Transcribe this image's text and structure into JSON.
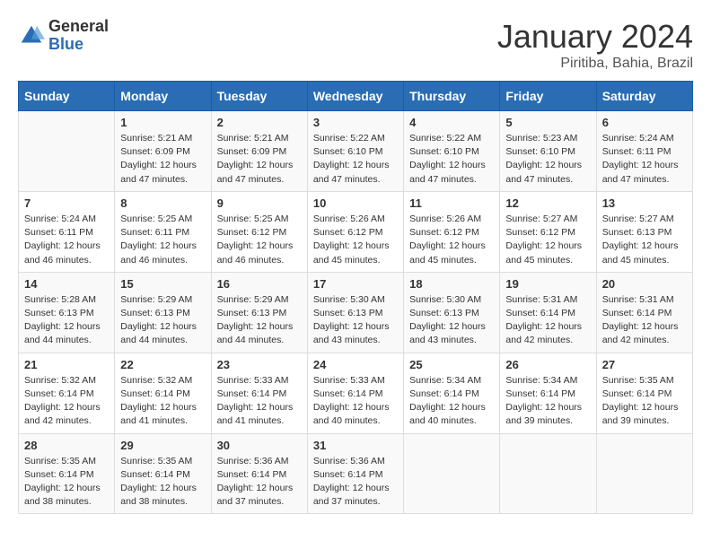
{
  "header": {
    "logo_general": "General",
    "logo_blue": "Blue",
    "title": "January 2024",
    "location": "Piritiba, Bahia, Brazil"
  },
  "weekdays": [
    "Sunday",
    "Monday",
    "Tuesday",
    "Wednesday",
    "Thursday",
    "Friday",
    "Saturday"
  ],
  "weeks": [
    [
      {
        "day": "",
        "info": ""
      },
      {
        "day": "1",
        "info": "Sunrise: 5:21 AM\nSunset: 6:09 PM\nDaylight: 12 hours\nand 47 minutes."
      },
      {
        "day": "2",
        "info": "Sunrise: 5:21 AM\nSunset: 6:09 PM\nDaylight: 12 hours\nand 47 minutes."
      },
      {
        "day": "3",
        "info": "Sunrise: 5:22 AM\nSunset: 6:10 PM\nDaylight: 12 hours\nand 47 minutes."
      },
      {
        "day": "4",
        "info": "Sunrise: 5:22 AM\nSunset: 6:10 PM\nDaylight: 12 hours\nand 47 minutes."
      },
      {
        "day": "5",
        "info": "Sunrise: 5:23 AM\nSunset: 6:10 PM\nDaylight: 12 hours\nand 47 minutes."
      },
      {
        "day": "6",
        "info": "Sunrise: 5:24 AM\nSunset: 6:11 PM\nDaylight: 12 hours\nand 47 minutes."
      }
    ],
    [
      {
        "day": "7",
        "info": "Sunrise: 5:24 AM\nSunset: 6:11 PM\nDaylight: 12 hours\nand 46 minutes."
      },
      {
        "day": "8",
        "info": "Sunrise: 5:25 AM\nSunset: 6:11 PM\nDaylight: 12 hours\nand 46 minutes."
      },
      {
        "day": "9",
        "info": "Sunrise: 5:25 AM\nSunset: 6:12 PM\nDaylight: 12 hours\nand 46 minutes."
      },
      {
        "day": "10",
        "info": "Sunrise: 5:26 AM\nSunset: 6:12 PM\nDaylight: 12 hours\nand 45 minutes."
      },
      {
        "day": "11",
        "info": "Sunrise: 5:26 AM\nSunset: 6:12 PM\nDaylight: 12 hours\nand 45 minutes."
      },
      {
        "day": "12",
        "info": "Sunrise: 5:27 AM\nSunset: 6:12 PM\nDaylight: 12 hours\nand 45 minutes."
      },
      {
        "day": "13",
        "info": "Sunrise: 5:27 AM\nSunset: 6:13 PM\nDaylight: 12 hours\nand 45 minutes."
      }
    ],
    [
      {
        "day": "14",
        "info": "Sunrise: 5:28 AM\nSunset: 6:13 PM\nDaylight: 12 hours\nand 44 minutes."
      },
      {
        "day": "15",
        "info": "Sunrise: 5:29 AM\nSunset: 6:13 PM\nDaylight: 12 hours\nand 44 minutes."
      },
      {
        "day": "16",
        "info": "Sunrise: 5:29 AM\nSunset: 6:13 PM\nDaylight: 12 hours\nand 44 minutes."
      },
      {
        "day": "17",
        "info": "Sunrise: 5:30 AM\nSunset: 6:13 PM\nDaylight: 12 hours\nand 43 minutes."
      },
      {
        "day": "18",
        "info": "Sunrise: 5:30 AM\nSunset: 6:13 PM\nDaylight: 12 hours\nand 43 minutes."
      },
      {
        "day": "19",
        "info": "Sunrise: 5:31 AM\nSunset: 6:14 PM\nDaylight: 12 hours\nand 42 minutes."
      },
      {
        "day": "20",
        "info": "Sunrise: 5:31 AM\nSunset: 6:14 PM\nDaylight: 12 hours\nand 42 minutes."
      }
    ],
    [
      {
        "day": "21",
        "info": "Sunrise: 5:32 AM\nSunset: 6:14 PM\nDaylight: 12 hours\nand 42 minutes."
      },
      {
        "day": "22",
        "info": "Sunrise: 5:32 AM\nSunset: 6:14 PM\nDaylight: 12 hours\nand 41 minutes."
      },
      {
        "day": "23",
        "info": "Sunrise: 5:33 AM\nSunset: 6:14 PM\nDaylight: 12 hours\nand 41 minutes."
      },
      {
        "day": "24",
        "info": "Sunrise: 5:33 AM\nSunset: 6:14 PM\nDaylight: 12 hours\nand 40 minutes."
      },
      {
        "day": "25",
        "info": "Sunrise: 5:34 AM\nSunset: 6:14 PM\nDaylight: 12 hours\nand 40 minutes."
      },
      {
        "day": "26",
        "info": "Sunrise: 5:34 AM\nSunset: 6:14 PM\nDaylight: 12 hours\nand 39 minutes."
      },
      {
        "day": "27",
        "info": "Sunrise: 5:35 AM\nSunset: 6:14 PM\nDaylight: 12 hours\nand 39 minutes."
      }
    ],
    [
      {
        "day": "28",
        "info": "Sunrise: 5:35 AM\nSunset: 6:14 PM\nDaylight: 12 hours\nand 38 minutes."
      },
      {
        "day": "29",
        "info": "Sunrise: 5:35 AM\nSunset: 6:14 PM\nDaylight: 12 hours\nand 38 minutes."
      },
      {
        "day": "30",
        "info": "Sunrise: 5:36 AM\nSunset: 6:14 PM\nDaylight: 12 hours\nand 37 minutes."
      },
      {
        "day": "31",
        "info": "Sunrise: 5:36 AM\nSunset: 6:14 PM\nDaylight: 12 hours\nand 37 minutes."
      },
      {
        "day": "",
        "info": ""
      },
      {
        "day": "",
        "info": ""
      },
      {
        "day": "",
        "info": ""
      }
    ]
  ]
}
